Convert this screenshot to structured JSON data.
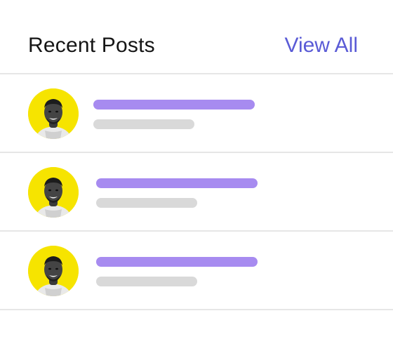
{
  "header": {
    "title": "Recent Posts",
    "view_all_label": "View All"
  },
  "colors": {
    "accent_link": "#5a5bd6",
    "title_bar": "#a78bf0",
    "subtitle_bar": "#d9d9d9",
    "avatar_background": "#f6e400",
    "divider": "#e6e6e6"
  },
  "posts": [
    {
      "avatar_icon": "user-avatar-photo"
    },
    {
      "avatar_icon": "user-avatar-photo"
    },
    {
      "avatar_icon": "user-avatar-photo"
    }
  ]
}
